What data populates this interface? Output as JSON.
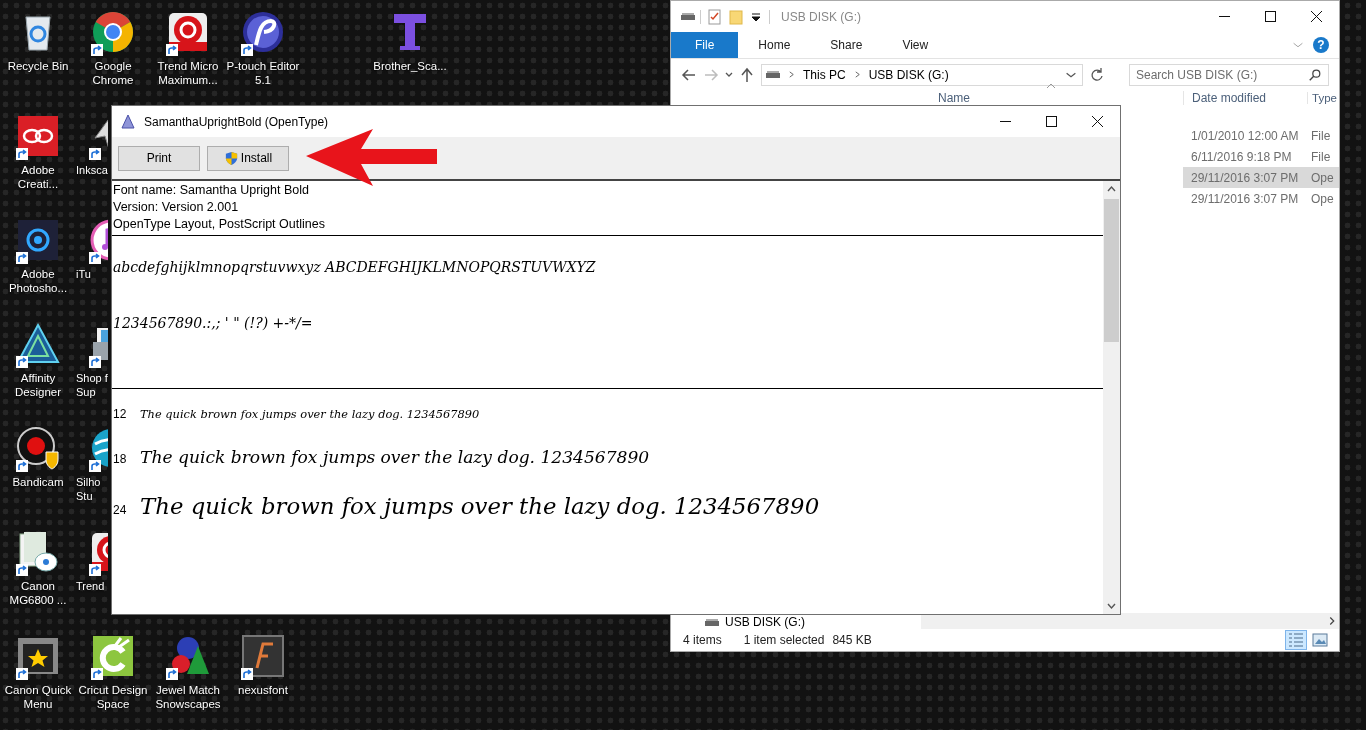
{
  "desktop_icons": [
    {
      "kind": "bin",
      "label": "Recycle Bin",
      "shortcut": false
    },
    {
      "kind": "browser",
      "label": "Google Chrome",
      "shortcut": true
    },
    {
      "kind": "swirl",
      "label": "Trend Micro Maximum...",
      "shortcut": true
    },
    {
      "kind": "disc",
      "label": "P-touch Editor 5.1",
      "shortcut": true
    },
    {
      "kind": "tee",
      "label": "Brother_Sca...",
      "shortcut": false
    },
    {
      "kind": "loops",
      "label": "Adobe Creati...",
      "shortcut": true
    },
    {
      "kind": "pen",
      "label": "Inksca",
      "shortcut": true
    },
    {
      "kind": "aperture",
      "label": "Adobe Photosho...",
      "shortcut": true
    },
    {
      "kind": "music",
      "label": "iTu",
      "shortcut": true
    },
    {
      "kind": "triangle",
      "label": "Affinity Designer",
      "shortcut": true
    },
    {
      "kind": "printer",
      "label": "Shop f\nSup",
      "shortcut": true
    },
    {
      "kind": "record",
      "label": "Bandicam",
      "shortcut": true
    },
    {
      "kind": "globe",
      "label": "Silho\nStu",
      "shortcut": true
    },
    {
      "kind": "helpdoc",
      "label": "Canon MG6800 ...",
      "shortcut": true
    },
    {
      "kind": "swirl",
      "label": "Trend",
      "shortcut": true
    },
    {
      "kind": "starbox",
      "label": "Canon Quick Menu",
      "shortcut": true
    },
    {
      "kind": "antenna",
      "label": "Cricut Design Space",
      "shortcut": true
    },
    {
      "kind": "ornaments",
      "label": "Jewel Match Snowscapes",
      "shortcut": true
    },
    {
      "kind": "fonttile",
      "label": "nexusfont",
      "shortcut": true
    }
  ],
  "explorer": {
    "title": "USB DISK (G:)",
    "ribbon_tabs": [
      {
        "label": "File",
        "selected": true
      },
      {
        "label": "Home",
        "selected": false
      },
      {
        "label": "Share",
        "selected": false
      },
      {
        "label": "View",
        "selected": false
      }
    ],
    "help": "?",
    "nav_buttons": [
      {
        "kind": "back",
        "disabled": false
      },
      {
        "kind": "forward",
        "disabled": true
      },
      {
        "kind": "recent",
        "disabled": false
      },
      {
        "kind": "up",
        "disabled": false
      }
    ],
    "breadcrumb": [
      "This PC",
      "USB DISK (G:)"
    ],
    "search": {
      "placeholder": "Search USB DISK (G:)"
    },
    "nav_items": [
      "USB DISK (G:)"
    ],
    "columns": [
      "Name",
      "Date modified",
      "Type"
    ],
    "rows": [
      {
        "date_modified": "1/01/2010 12:00 AM",
        "type": "File",
        "selected": false
      },
      {
        "date_modified": "6/11/2016 9:18 PM",
        "type": "File",
        "selected": false
      },
      {
        "date_modified": "29/11/2016 3:07 PM",
        "type": "Ope",
        "selected": true
      },
      {
        "date_modified": "29/11/2016 3:07 PM",
        "type": "Ope",
        "selected": false
      }
    ],
    "status": {
      "item_count": "4 items",
      "selection": "1 item selected",
      "selection_size": "845 KB"
    },
    "view_buttons": [
      {
        "kind": "details",
        "selected": true
      },
      {
        "kind": "thumbnails",
        "selected": false
      }
    ]
  },
  "font_viewer": {
    "title": "SamanthaUprightBold (OpenType)",
    "buttons": [
      {
        "kind": "plain",
        "label": "Print"
      },
      {
        "kind": "shield",
        "label": "Install"
      }
    ],
    "info": [
      "Font name: Samantha Upright Bold",
      "Version: Version 2.001",
      "OpenType Layout, PostScript Outlines"
    ],
    "character_samples": [
      "abcdefghijklmnopqrstuvwxyz ABCDEFGHIJKLMNOPQRSTUVWXYZ",
      "1234567890.:,; ' \" (!?) +-*/="
    ],
    "size_samples": [
      {
        "size": "12",
        "text": "The quick brown fox jumps over the lazy dog. 1234567890"
      },
      {
        "size": "18",
        "text": "The quick brown fox jumps over the lazy dog. 1234567890"
      },
      {
        "size": "24",
        "text": "The quick brown fox jumps over the lazy dog. 1234567890"
      }
    ]
  }
}
